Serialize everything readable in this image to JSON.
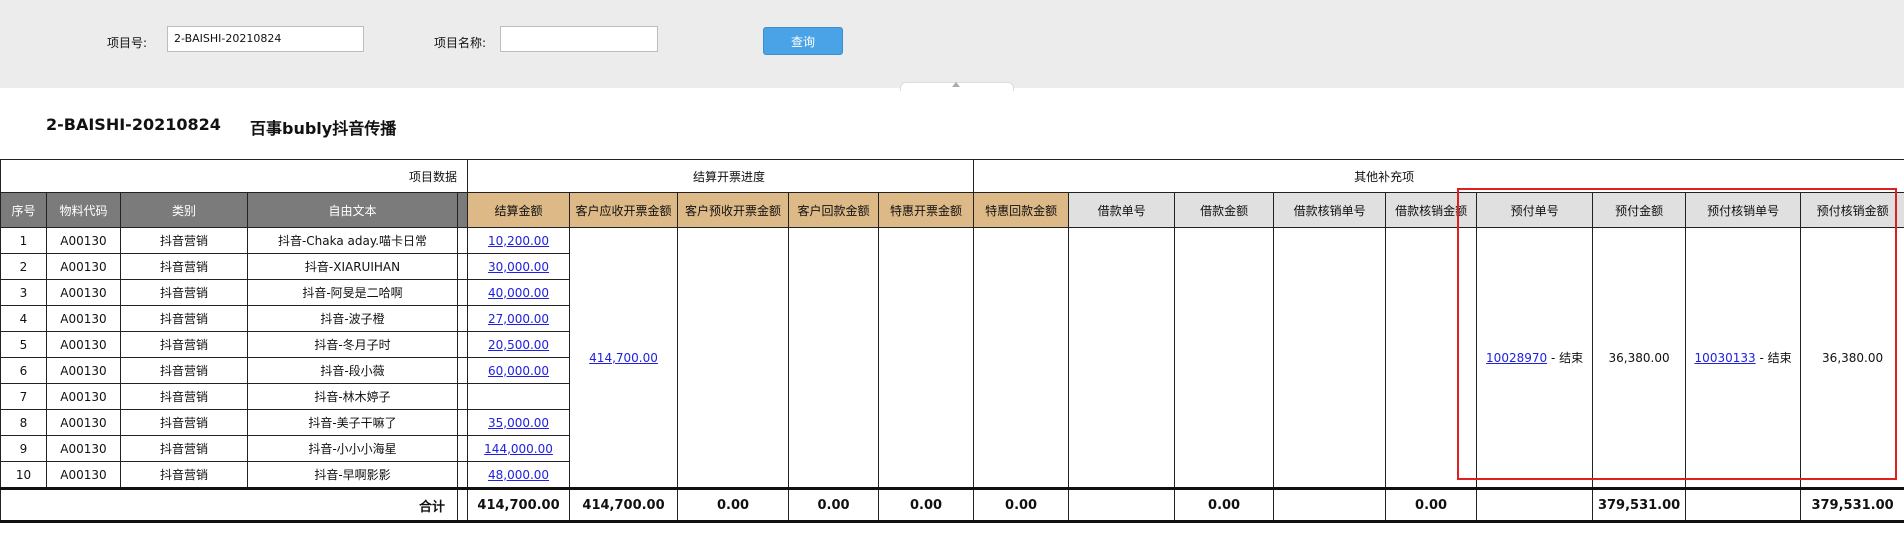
{
  "search": {
    "project_no_label": "项目号:",
    "project_no_value": "2-BAISHI-20210824",
    "project_name_label": "项目名称:",
    "project_name_value": "",
    "query_button": "查询"
  },
  "page": {
    "project_code": "2-BAISHI-20210824",
    "project_name": "百事bubly抖音传播"
  },
  "sections": {
    "project_data": "项目数据",
    "settlement": "结算开票进度",
    "other": "其他补充项"
  },
  "columns": {
    "seq": "序号",
    "material": "物料代码",
    "category": "类别",
    "free_text": "自由文本",
    "settle_amount": "结算金额",
    "cust_invoice": "客户应收开票金额",
    "cust_pre_invoice": "客户预收开票金额",
    "cust_payback": "客户回款金额",
    "special_invoice": "特惠开票金额",
    "special_payback": "特惠回款金额",
    "loan_no": "借款单号",
    "loan_amount": "借款金额",
    "loan_writeoff_no": "借款核销单号",
    "loan_writeoff_amount": "借款核销金额",
    "prepay_no": "预付单号",
    "prepay_amount": "预付金额",
    "prepay_writeoff_no": "预付核销单号",
    "prepay_writeoff_amount": "预付核销金额"
  },
  "rows": [
    {
      "seq": "1",
      "material": "A00130",
      "category": "抖音营销",
      "text": "抖音-Chaka aday.喵卡日常",
      "amount": "10,200.00"
    },
    {
      "seq": "2",
      "material": "A00130",
      "category": "抖音营销",
      "text": "抖音-XIARUIHAN",
      "amount": "30,000.00"
    },
    {
      "seq": "3",
      "material": "A00130",
      "category": "抖音营销",
      "text": "抖音-阿旻是二哈啊",
      "amount": "40,000.00"
    },
    {
      "seq": "4",
      "material": "A00130",
      "category": "抖音营销",
      "text": "抖音-波子橙",
      "amount": "27,000.00"
    },
    {
      "seq": "5",
      "material": "A00130",
      "category": "抖音营销",
      "text": "抖音-冬月子时",
      "amount": "20,500.00"
    },
    {
      "seq": "6",
      "material": "A00130",
      "category": "抖音营销",
      "text": "抖音-段小薇",
      "amount": "60,000.00"
    },
    {
      "seq": "7",
      "material": "A00130",
      "category": "抖音营销",
      "text": "抖音-林木婷子",
      "amount": ""
    },
    {
      "seq": "8",
      "material": "A00130",
      "category": "抖音营销",
      "text": "抖音-美子干嘛了",
      "amount": "35,000.00"
    },
    {
      "seq": "9",
      "material": "A00130",
      "category": "抖音营销",
      "text": "抖音-小小小海星",
      "amount": "144,000.00"
    },
    {
      "seq": "10",
      "material": "A00130",
      "category": "抖音营销",
      "text": "抖音-早啊影影",
      "amount": "48,000.00"
    }
  ],
  "merged": {
    "cust_invoice": "414,700.00",
    "prepay_no_link": "10028970",
    "prepay_no_status": " - 结束",
    "prepay_amount": "36,380.00",
    "prepay_writeoff_link": "10030133",
    "prepay_writeoff_status": " - 结束",
    "prepay_writeoff_amount": "36,380.00"
  },
  "summary": {
    "label": "合计",
    "settle_amount": "414,700.00",
    "cust_invoice": "414,700.00",
    "cust_pre_invoice": "0.00",
    "cust_payback": "0.00",
    "special_invoice": "0.00",
    "special_payback": "0.00",
    "loan_amount": "0.00",
    "loan_writeoff_amount": "0.00",
    "prepay_amount": "379,531.00",
    "prepay_writeoff_amount": "379,531.00"
  },
  "colors": {
    "header_gray": "#7b7b7b",
    "header_tan": "#dcb986",
    "header_light": "#e0e0e0",
    "query_button": "#49a3e6",
    "link": "#2020e0",
    "highlight_box": "#e02020"
  }
}
